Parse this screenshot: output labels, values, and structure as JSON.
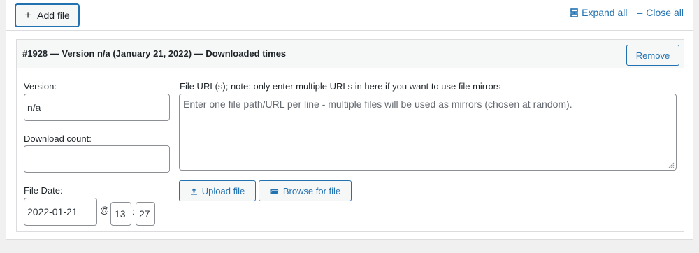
{
  "toolbar": {
    "add_file_label": "Add file",
    "add_icon": "plus-icon",
    "expand_all_label": "Expand all",
    "collapse_all_label": "Close all"
  },
  "file": {
    "title": "#1928 — Version n/a (January 21, 2022) — Downloaded times",
    "remove_label": "Remove",
    "version_label": "Version:",
    "version_value": "n/a",
    "download_count_label": "Download count:",
    "download_count_value": "",
    "file_date_label": "File Date:",
    "date_value": "2022-01-21",
    "at_symbol": "@",
    "hour_value": "13",
    "time_separator": ":",
    "minute_value": "27",
    "urls_label": "File URL(s); note: only enter multiple URLs in here if you want to use file mirrors",
    "urls_placeholder": "Enter one file path/URL per line - multiple files will be used as mirrors (chosen at random).",
    "upload_label": "Upload file",
    "browse_label": "Browse for file"
  },
  "colors": {
    "accent": "#2271b1",
    "border": "#dcdcde",
    "background": "#f0f0f1"
  }
}
